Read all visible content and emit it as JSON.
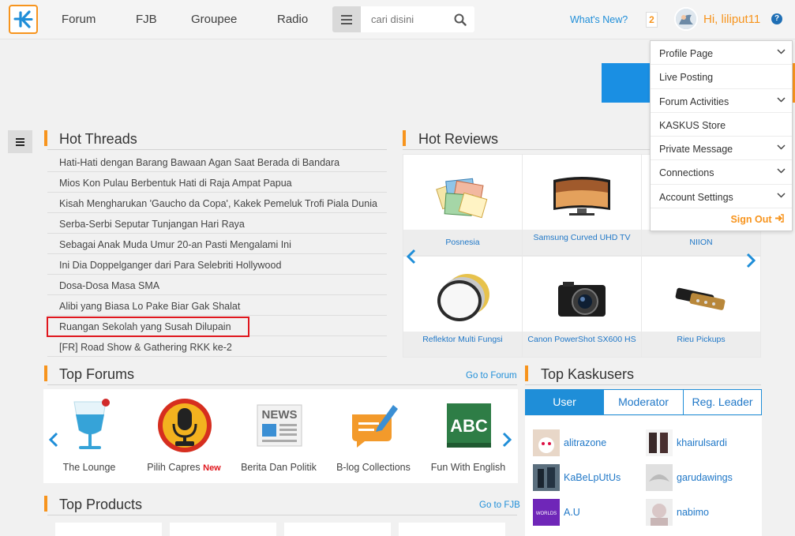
{
  "header": {
    "nav": [
      "Forum",
      "FJB",
      "Groupee",
      "Radio"
    ],
    "search_placeholder": "cari disini",
    "whats_new": "What's New?",
    "notif_count": "2",
    "greeting": "Hi, liliput11",
    "help": "?"
  },
  "user_menu": {
    "items": [
      {
        "label": "Profile Page",
        "has_sub": true
      },
      {
        "label": "Live Posting",
        "has_sub": false
      },
      {
        "label": "Forum Activities",
        "has_sub": true
      },
      {
        "label": "KASKUS Store",
        "has_sub": false
      },
      {
        "label": "Private Message",
        "has_sub": true
      },
      {
        "label": "Connections",
        "has_sub": true
      },
      {
        "label": "Account Settings",
        "has_sub": true
      }
    ],
    "sign_out": "Sign Out"
  },
  "hot_threads": {
    "title": "Hot Threads",
    "items": [
      "Hati-Hati dengan Barang Bawaan Agan Saat Berada di Bandara",
      "Mios Kon Pulau Berbentuk Hati di Raja Ampat Papua",
      "Kisah Mengharukan 'Gaucho da Copa', Kakek Pemeluk Trofi Piala Dunia",
      "Serba-Serbi Seputar Tunjangan Hari Raya",
      "Sebagai Anak Muda Umur 20-an Pasti Mengalami Ini",
      "Ini Dia Doppelganger dari Para Selebriti Hollywood",
      "Dosa-Dosa Masa SMA",
      "Alibi yang Biasa Lo Pake Biar Gak Shalat",
      "Ruangan Sekolah yang Susah Dilupain",
      "[FR] Road Show & Gathering RKK ke-2"
    ]
  },
  "hot_reviews": {
    "title": "Hot Reviews",
    "items": [
      {
        "name": "Posnesia",
        "icon": "stamps-icon"
      },
      {
        "name": "Samsung Curved UHD TV",
        "icon": "tv-icon"
      },
      {
        "name": "NIION",
        "icon": "product-icon"
      },
      {
        "name": "Reflektor Multi Fungsi",
        "icon": "reflector-icon"
      },
      {
        "name": "Canon PowerShot SX600 HS",
        "icon": "camera-icon"
      },
      {
        "name": "Rieu Pickups",
        "icon": "pickup-icon"
      }
    ]
  },
  "top_forums": {
    "title": "Top Forums",
    "link": "Go to Forum",
    "items": [
      {
        "name": "The Lounge",
        "badge": ""
      },
      {
        "name": "Pilih Capres",
        "badge": "New"
      },
      {
        "name": "Berita Dan Politik",
        "badge": ""
      },
      {
        "name": "B-log Collections",
        "badge": ""
      },
      {
        "name": "Fun With English",
        "badge": ""
      }
    ],
    "news_icon_text": "NEWS",
    "abc_icon_text": "ABC"
  },
  "top_kaskusers": {
    "title": "Top Kaskusers",
    "tabs": [
      "User",
      "Moderator",
      "Reg. Leader"
    ],
    "active_tab": "User",
    "users": [
      "alitrazone",
      "khairulsardi",
      "KaBeLpUtUs",
      "garudawings",
      "A.U",
      "nabimo"
    ],
    "worlds_avatar_text": "WORLDS"
  },
  "top_products": {
    "title": "Top Products",
    "link": "Go to FJB"
  },
  "colors": {
    "accent": "#f7941d",
    "link": "#1f8ed8",
    "highlight": "#e0171e"
  }
}
